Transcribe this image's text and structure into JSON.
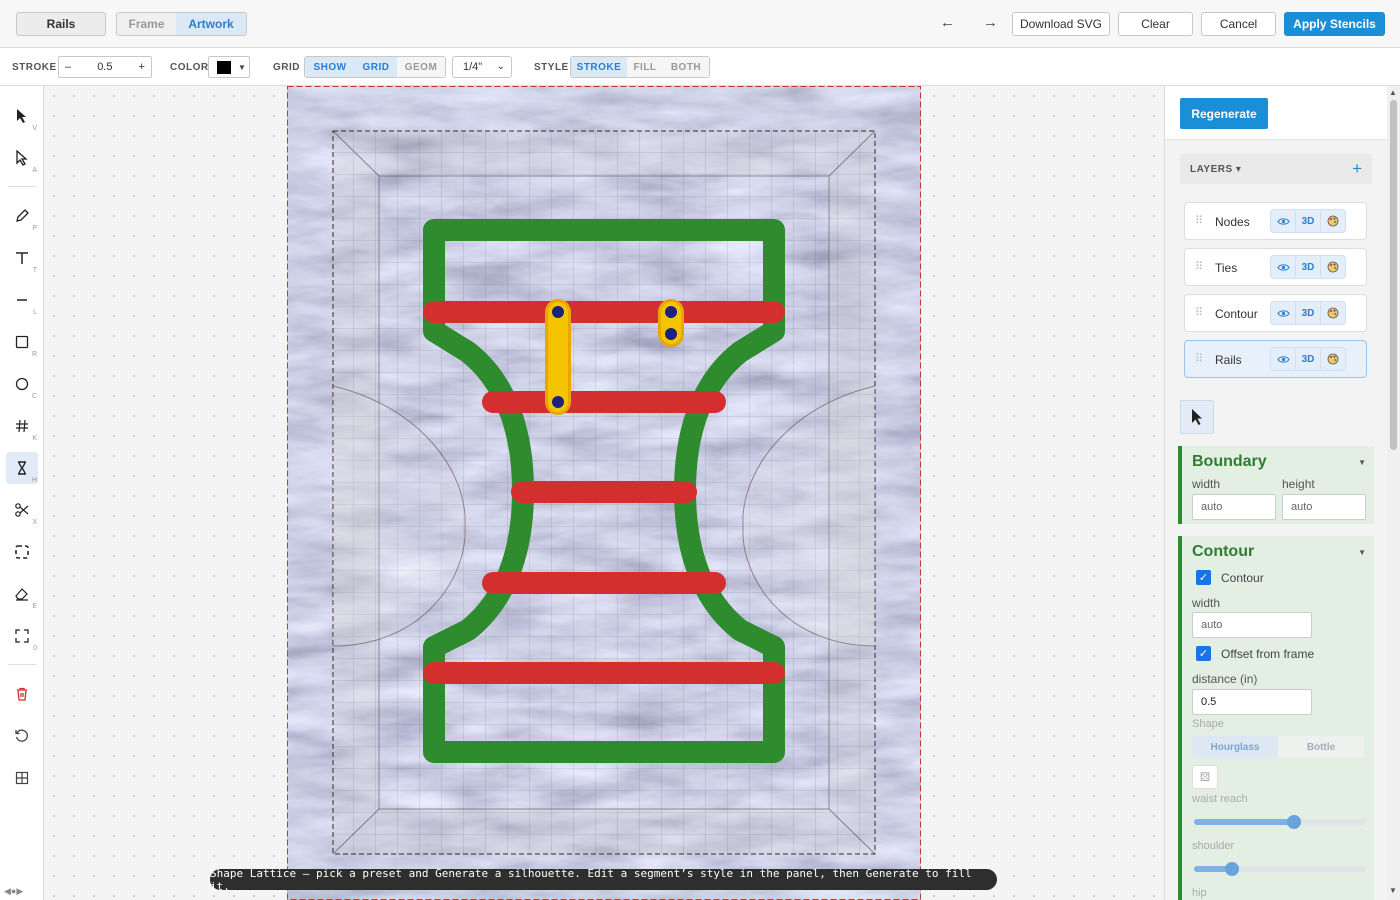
{
  "topbar": {
    "mode_label": "Rails",
    "tabs": [
      {
        "label": "Frame",
        "active": false
      },
      {
        "label": "Artwork",
        "active": true
      }
    ],
    "undo_icon": "arrow-left-icon",
    "redo_icon": "arrow-right-icon",
    "download_label": "Download SVG",
    "clear_label": "Clear",
    "cancel_label": "Cancel",
    "apply_label": "Apply Stencils"
  },
  "toolbar": {
    "stroke_label": "STROKE",
    "stroke_minus": "–",
    "stroke_value": "0.5",
    "stroke_plus": "+",
    "color_label": "COLOR",
    "color_value": "#000000",
    "grid_label": "GRID",
    "grid_options": [
      {
        "label": "SHOW",
        "active": true
      },
      {
        "label": "GRID",
        "active": true
      },
      {
        "label": "GEOM",
        "active": false
      }
    ],
    "grid_size": "1/4\"",
    "style_label": "STYLE",
    "style_options": [
      {
        "label": "STROKE",
        "active": true
      },
      {
        "label": "FILL",
        "active": false
      },
      {
        "label": "BOTH",
        "active": false
      }
    ]
  },
  "tools": [
    {
      "name": "select",
      "key": "V"
    },
    {
      "name": "direct-select",
      "key": "A"
    },
    {
      "name": "pen",
      "key": "P"
    },
    {
      "name": "text",
      "key": "T"
    },
    {
      "name": "line",
      "key": "L"
    },
    {
      "name": "rectangle",
      "key": "R"
    },
    {
      "name": "ellipse",
      "key": "C"
    },
    {
      "name": "grid",
      "key": "K"
    },
    {
      "name": "hourglass",
      "key": "H"
    },
    {
      "name": "scissors",
      "key": "X"
    },
    {
      "name": "frame",
      "key": ""
    },
    {
      "name": "eraser",
      "key": "E"
    },
    {
      "name": "fit",
      "key": "0"
    }
  ],
  "status_text": "Shape Lattice — pick a preset and Generate a silhouette. Edit a segment’s style in the panel, then Generate to fill it.",
  "panel": {
    "regenerate_label": "Regenerate",
    "layers_title": "LAYERS ▾",
    "layers_add": "+",
    "layers": [
      {
        "name": "Nodes",
        "selected": false
      },
      {
        "name": "Ties",
        "selected": false
      },
      {
        "name": "Contour",
        "selected": false
      },
      {
        "name": "Rails",
        "selected": true
      }
    ],
    "layer_3d_label": "3D",
    "boundary": {
      "title": "Boundary",
      "width_label": "width",
      "width_value": "auto",
      "height_label": "height",
      "height_value": "auto"
    },
    "contour": {
      "title": "Contour",
      "contour_checkbox_label": "Contour",
      "width_label": "width",
      "width_value": "auto",
      "offset_checkbox_label": "Offset from frame",
      "distance_label": "distance (in)",
      "distance_value": "0.5",
      "shape_label": "Shape",
      "shape_options": [
        {
          "label": "Hourglass",
          "active": true
        },
        {
          "label": "Bottle",
          "active": false
        }
      ],
      "waist_label": "waist reach",
      "waist_value": 0.58,
      "shoulder_label": "shoulder",
      "shoulder_value": 0.22,
      "hip_label": "hip"
    }
  },
  "colors": {
    "accent": "#1a8fd8",
    "contour_green": "#2e8b2e",
    "rail_red": "#d32f2f",
    "tie_yellow": "#f5b800",
    "node_navy": "#1a237e"
  }
}
